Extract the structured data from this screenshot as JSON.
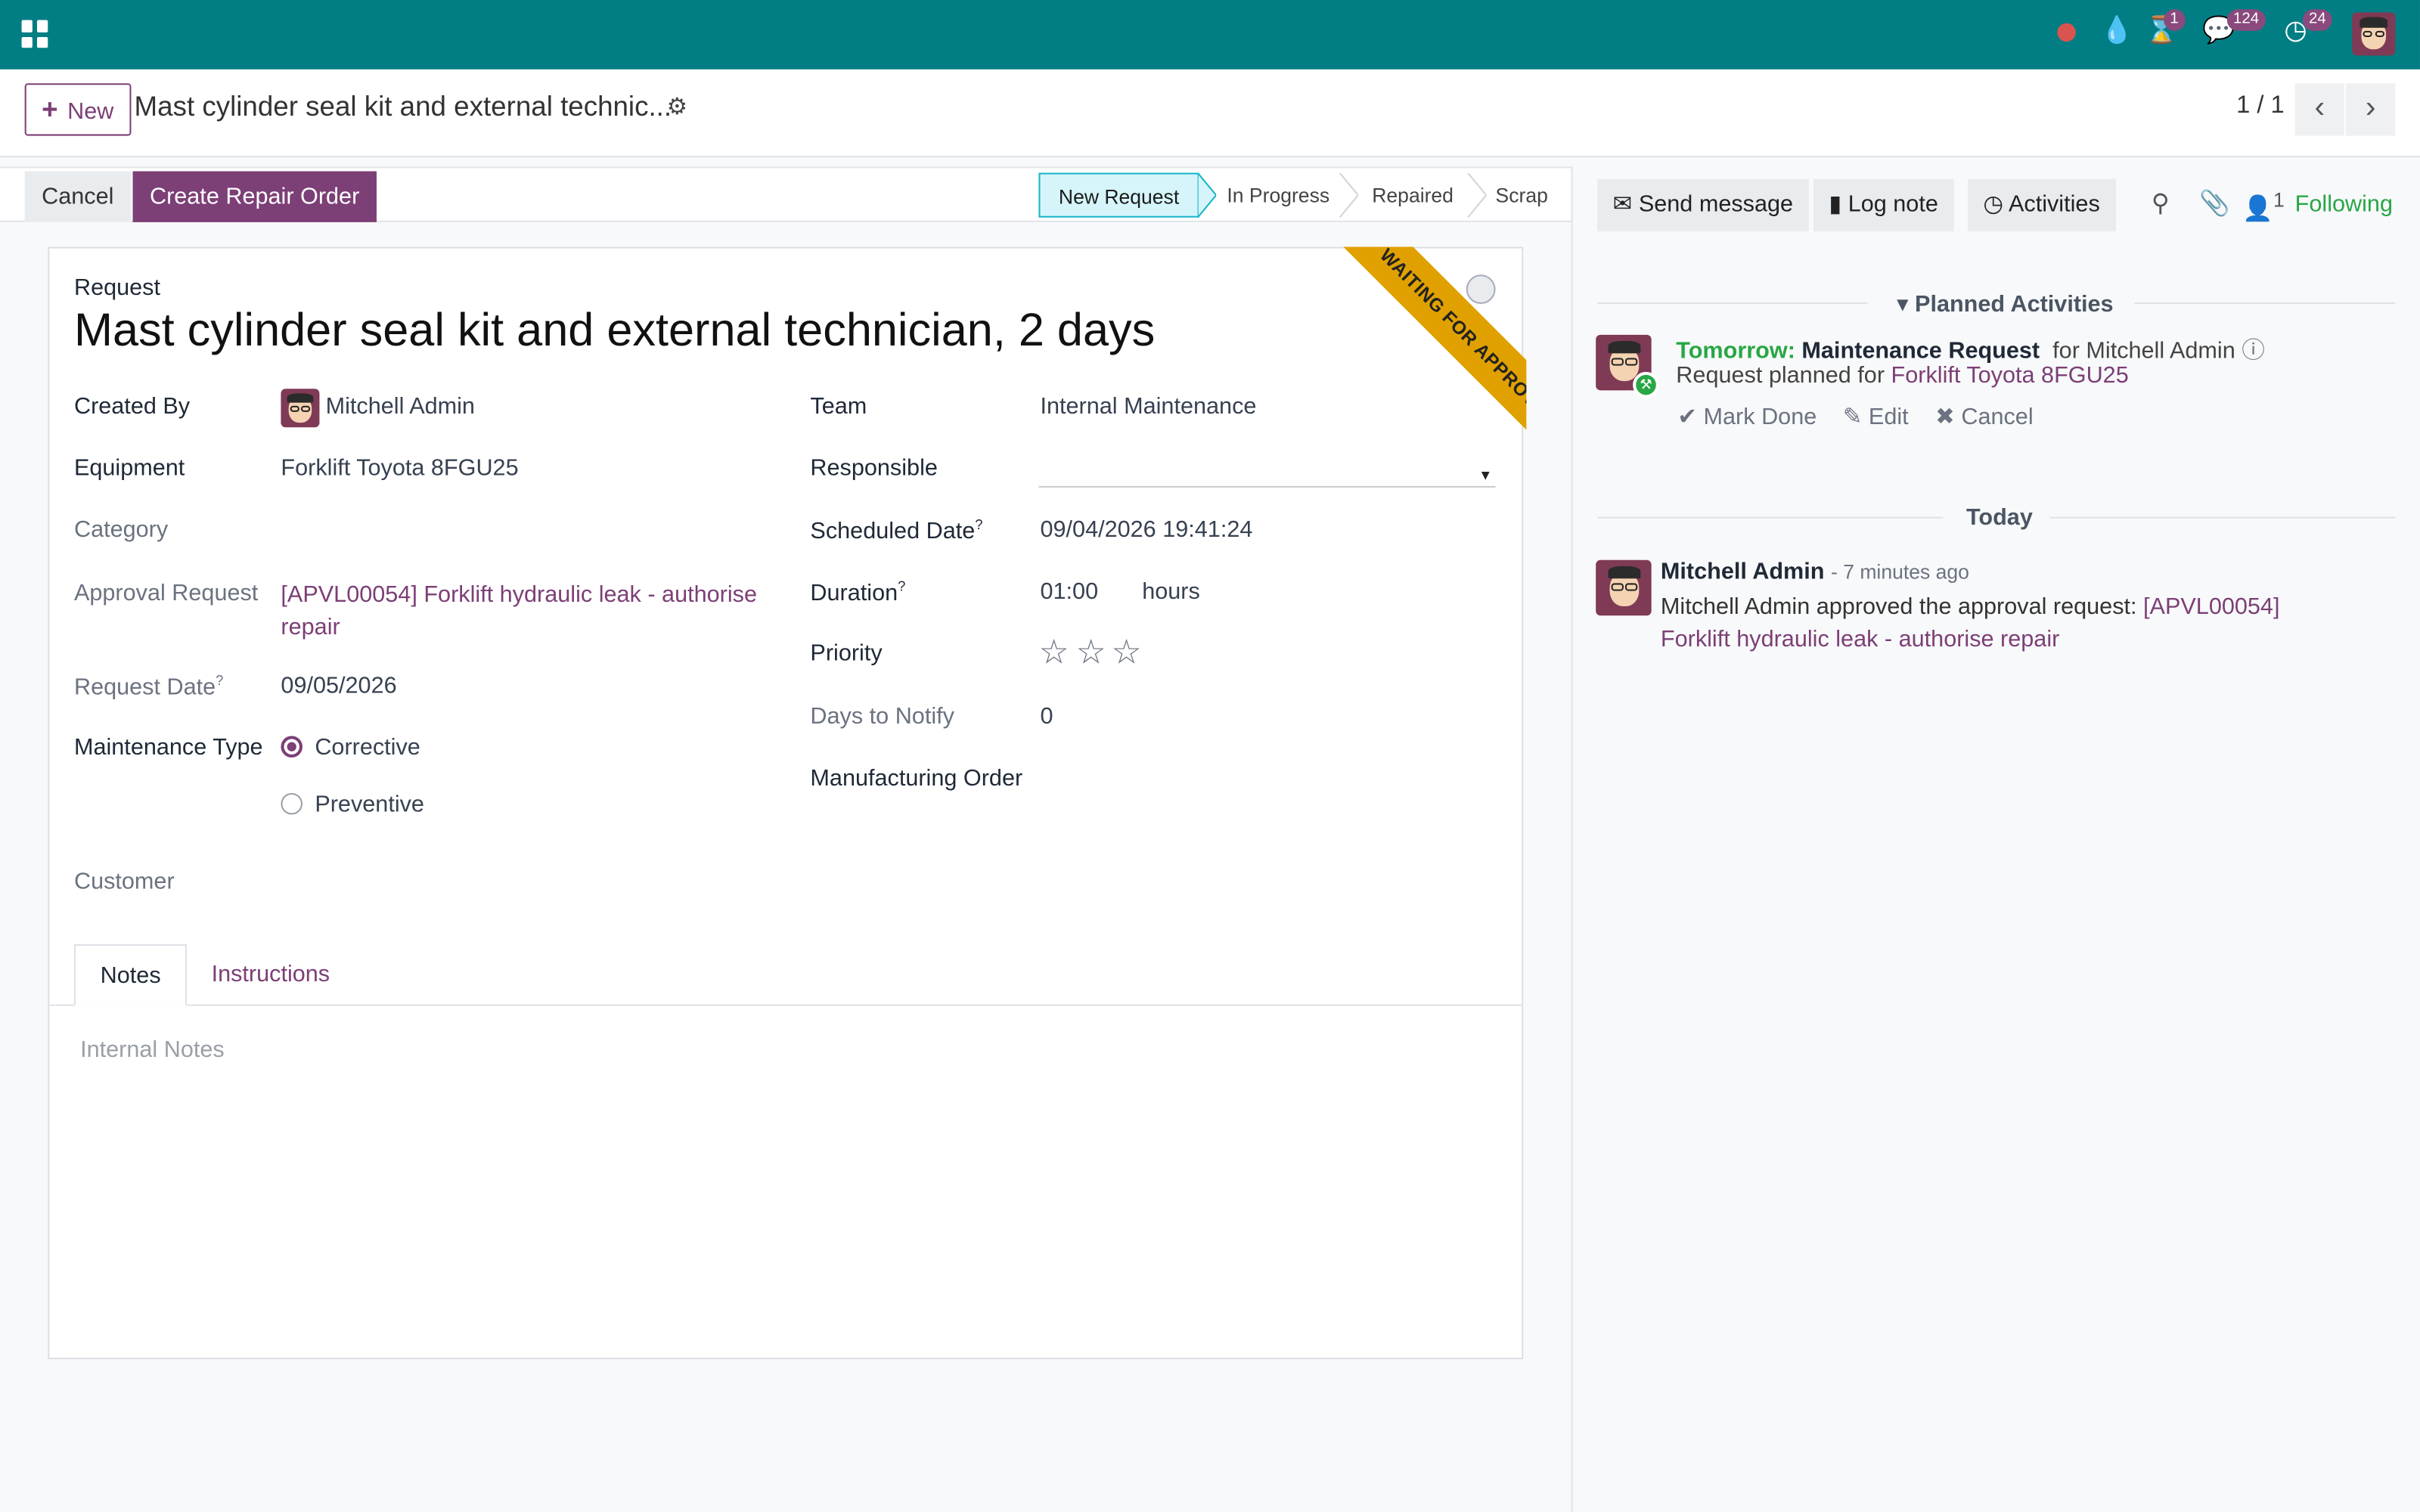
{
  "navbar": {
    "badges": {
      "activities": "1",
      "messages": "124",
      "clock": "24"
    }
  },
  "control_panel": {
    "new_label": "New",
    "breadcrumb_title": "Mast cylinder seal kit and external technic...",
    "pager": "1 / 1"
  },
  "status_bar": {
    "cancel_label": "Cancel",
    "create_repair_label": "Create Repair Order",
    "stages": [
      "New Request",
      "In Progress",
      "Repaired",
      "Scrap"
    ],
    "active_stage": "New Request"
  },
  "form": {
    "ribbon": "WAITING FOR APPROVAL",
    "request_label": "Request",
    "title": "Mast cylinder seal kit and external technician, 2 days",
    "left": {
      "created_by_label": "Created By",
      "created_by": "Mitchell Admin",
      "equipment_label": "Equipment",
      "equipment": "Forklift Toyota 8FGU25",
      "category_label": "Category",
      "approval_label": "Approval Request",
      "approval_line1": "[APVL00054] Forklift hydraulic leak - authorise",
      "approval_line2": "repair",
      "request_date_label": "Request Date",
      "request_date": "09/05/2026",
      "maint_type_label": "Maintenance Type",
      "maint_type_options": [
        "Corrective",
        "Preventive"
      ],
      "maint_type_selected": "Corrective",
      "customer_label": "Customer"
    },
    "right": {
      "team_label": "Team",
      "team": "Internal Maintenance",
      "responsible_label": "Responsible",
      "responsible": "",
      "scheduled_label": "Scheduled Date",
      "scheduled": "09/04/2026 19:41:24",
      "duration_label": "Duration",
      "duration": "01:00",
      "duration_unit": "hours",
      "priority_label": "Priority",
      "priority_stars": 0,
      "days_notify_label": "Days to Notify",
      "days_notify": "0",
      "mo_label": "Manufacturing Order"
    },
    "help_mark": "?",
    "tabs": [
      "Notes",
      "Instructions"
    ],
    "notes_placeholder": "Internal Notes"
  },
  "chatter": {
    "send_message": "Send message",
    "log_note": "Log note",
    "activities": "Activities",
    "followers_count": "1",
    "following": "Following",
    "planned_title": "Planned Activities",
    "activity": {
      "when": "Tomorrow:",
      "type": "Maintenance Request",
      "for": "for Mitchell Admin",
      "summary_prefix": "Request planned for",
      "summary_link": "Forklift Toyota 8FGU25",
      "mark_done": "Mark Done",
      "edit": "Edit",
      "cancel": "Cancel"
    },
    "today_label": "Today",
    "message": {
      "author": "Mitchell Admin",
      "time": "- 7 minutes ago",
      "text_prefix": "Mitchell Admin approved the approval request:",
      "link_part1": "[APVL00054]",
      "link_part2": "Forklift hydraulic leak - authorise repair"
    }
  }
}
